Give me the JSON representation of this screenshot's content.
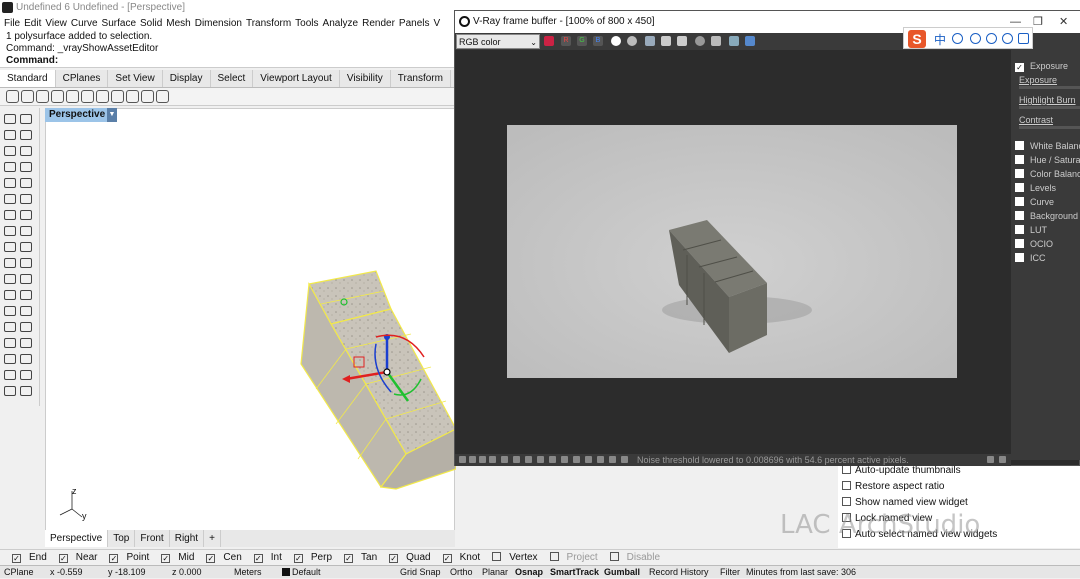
{
  "rhino": {
    "title": "Undefined 6 Undefined - [Perspective]",
    "menu": [
      "File",
      "Edit",
      "View",
      "Curve",
      "Surface",
      "Solid",
      "Mesh",
      "Dimension",
      "Transform",
      "Tools",
      "Analyze",
      "Render",
      "Panels",
      "V"
    ],
    "history_line1": "1 polysurface added to selection.",
    "history_line2": "Command: _vrayShowAssetEditor",
    "command_label": "Command:",
    "toolbar_tabs": [
      "Standard",
      "CPlanes",
      "Set View",
      "Display",
      "Select",
      "Viewport Layout",
      "Visibility",
      "Transform"
    ],
    "viewport_label": "Perspective",
    "view_tabs": [
      "Perspective",
      "Top",
      "Front",
      "Right"
    ],
    "axis_z": "z",
    "axis_y": "y",
    "osnaps": [
      {
        "label": "End",
        "checked": true
      },
      {
        "label": "Near",
        "checked": true
      },
      {
        "label": "Point",
        "checked": true
      },
      {
        "label": "Mid",
        "checked": true
      },
      {
        "label": "Cen",
        "checked": true
      },
      {
        "label": "Int",
        "checked": true
      },
      {
        "label": "Perp",
        "checked": true
      },
      {
        "label": "Tan",
        "checked": true
      },
      {
        "label": "Quad",
        "checked": true
      },
      {
        "label": "Knot",
        "checked": true
      },
      {
        "label": "Vertex",
        "checked": false
      },
      {
        "label": "Project",
        "checked": false
      },
      {
        "label": "Disable",
        "checked": false
      }
    ],
    "status": {
      "cplane": "CPlane",
      "x": "x -0.559",
      "y": "y -18.109",
      "z": "z 0.000",
      "units": "Meters",
      "layer": "Default",
      "grid_snap": "Grid Snap",
      "ortho": "Ortho",
      "planar": "Planar",
      "osnap": "Osnap",
      "smarttrack": "SmartTrack",
      "gumball": "Gumball",
      "record_history": "Record History",
      "filter": "Filter",
      "save_info": "Minutes from last save: 306"
    },
    "named_view_options": [
      {
        "label": "Auto-update thumbnails",
        "checked": false
      },
      {
        "label": "Restore aspect ratio",
        "checked": false
      },
      {
        "label": "Show named view widget",
        "checked": false
      },
      {
        "label": "Lock named view",
        "checked": false
      },
      {
        "label": "Auto select named view widgets",
        "checked": false
      }
    ]
  },
  "vray": {
    "title": "V-Ray frame buffer - [100% of 800 x 450]",
    "channel": "RGB color",
    "channel_buttons": [
      "R",
      "G",
      "B"
    ],
    "status_message": "Noise threshold lowered to 0.008696 with 54.6 percent active pixels.",
    "corrections": {
      "exposure": {
        "label": "Exposure",
        "checked": true
      },
      "sliders": [
        "Exposure",
        "Highlight Burn",
        "Contrast"
      ],
      "layers": [
        "White Balance",
        "Hue / Saturation",
        "Color Balance",
        "Levels",
        "Curve",
        "Background",
        "LUT",
        "OCIO",
        "ICC"
      ]
    }
  },
  "ime": {
    "logo": "S",
    "lang": "中"
  },
  "watermark": "LAC ArchStudio",
  "colors": {
    "selection_yellow": "#f2e94a",
    "gizmo_red": "#e02020",
    "gizmo_blue": "#1a3fd0",
    "gizmo_green": "#20c030",
    "vp_label": "#9cc4e8"
  }
}
